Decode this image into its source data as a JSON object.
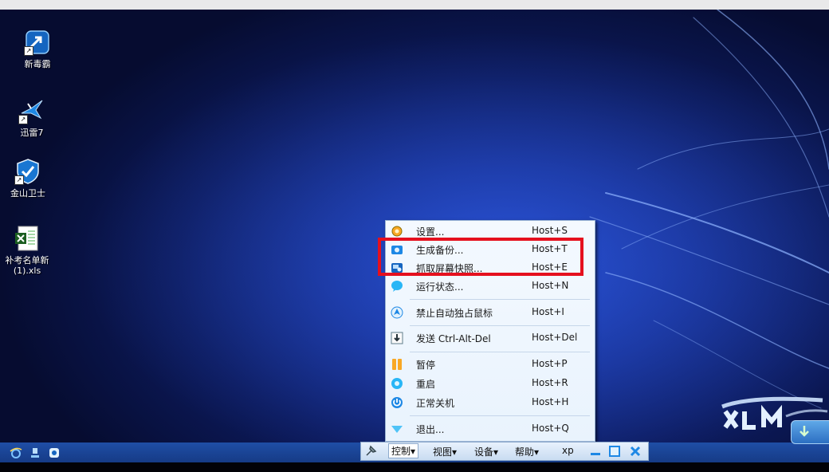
{
  "desktop_icons": [
    {
      "id": "new-toxin",
      "label": "新毒霸",
      "icon": "shield-arrow-icon"
    },
    {
      "id": "xunlei",
      "label": "迅雷7",
      "icon": "bird-icon"
    },
    {
      "id": "jinshan-guard",
      "label": "金山卫士",
      "icon": "shield-check-icon"
    },
    {
      "id": "excel-file",
      "label_line1": "补考名单新",
      "label_line2": "(1).xls",
      "icon": "excel-icon"
    }
  ],
  "control_menu": {
    "items": [
      {
        "label": "设置...",
        "shortcut": "Host+S",
        "icon": "gear-icon"
      },
      {
        "label": "生成备份...",
        "shortcut": "Host+T",
        "icon": "snapshot-icon"
      },
      {
        "label": "抓取屏幕快照...",
        "shortcut": "Host+E",
        "icon": "screenshot-icon"
      },
      {
        "label": "运行状态...",
        "shortcut": "Host+N",
        "icon": "info-bubble-icon"
      },
      {
        "label": "禁止自动独占鼠标",
        "shortcut": "Host+I",
        "icon": "mouse-capture-icon"
      },
      {
        "label": "发送 Ctrl-Alt-Del",
        "shortcut": "Host+Del",
        "icon": "keyboard-send-icon"
      },
      {
        "label": "暂停",
        "shortcut": "Host+P",
        "icon": "pause-icon"
      },
      {
        "label": "重启",
        "shortcut": "Host+R",
        "icon": "restart-icon"
      },
      {
        "label": "正常关机",
        "shortcut": "Host+H",
        "icon": "power-icon"
      },
      {
        "label": "退出...",
        "shortcut": "Host+Q",
        "icon": "exit-icon"
      }
    ]
  },
  "toolbar": {
    "menus": [
      {
        "label": "控制"
      },
      {
        "label": "视图"
      },
      {
        "label": "设备"
      },
      {
        "label": "帮助"
      }
    ],
    "os_label": "xp"
  },
  "colors": {
    "highlight": "#e5101e",
    "menu_bg": "#f4f9ff",
    "taskbar": "#1f4ea6"
  }
}
